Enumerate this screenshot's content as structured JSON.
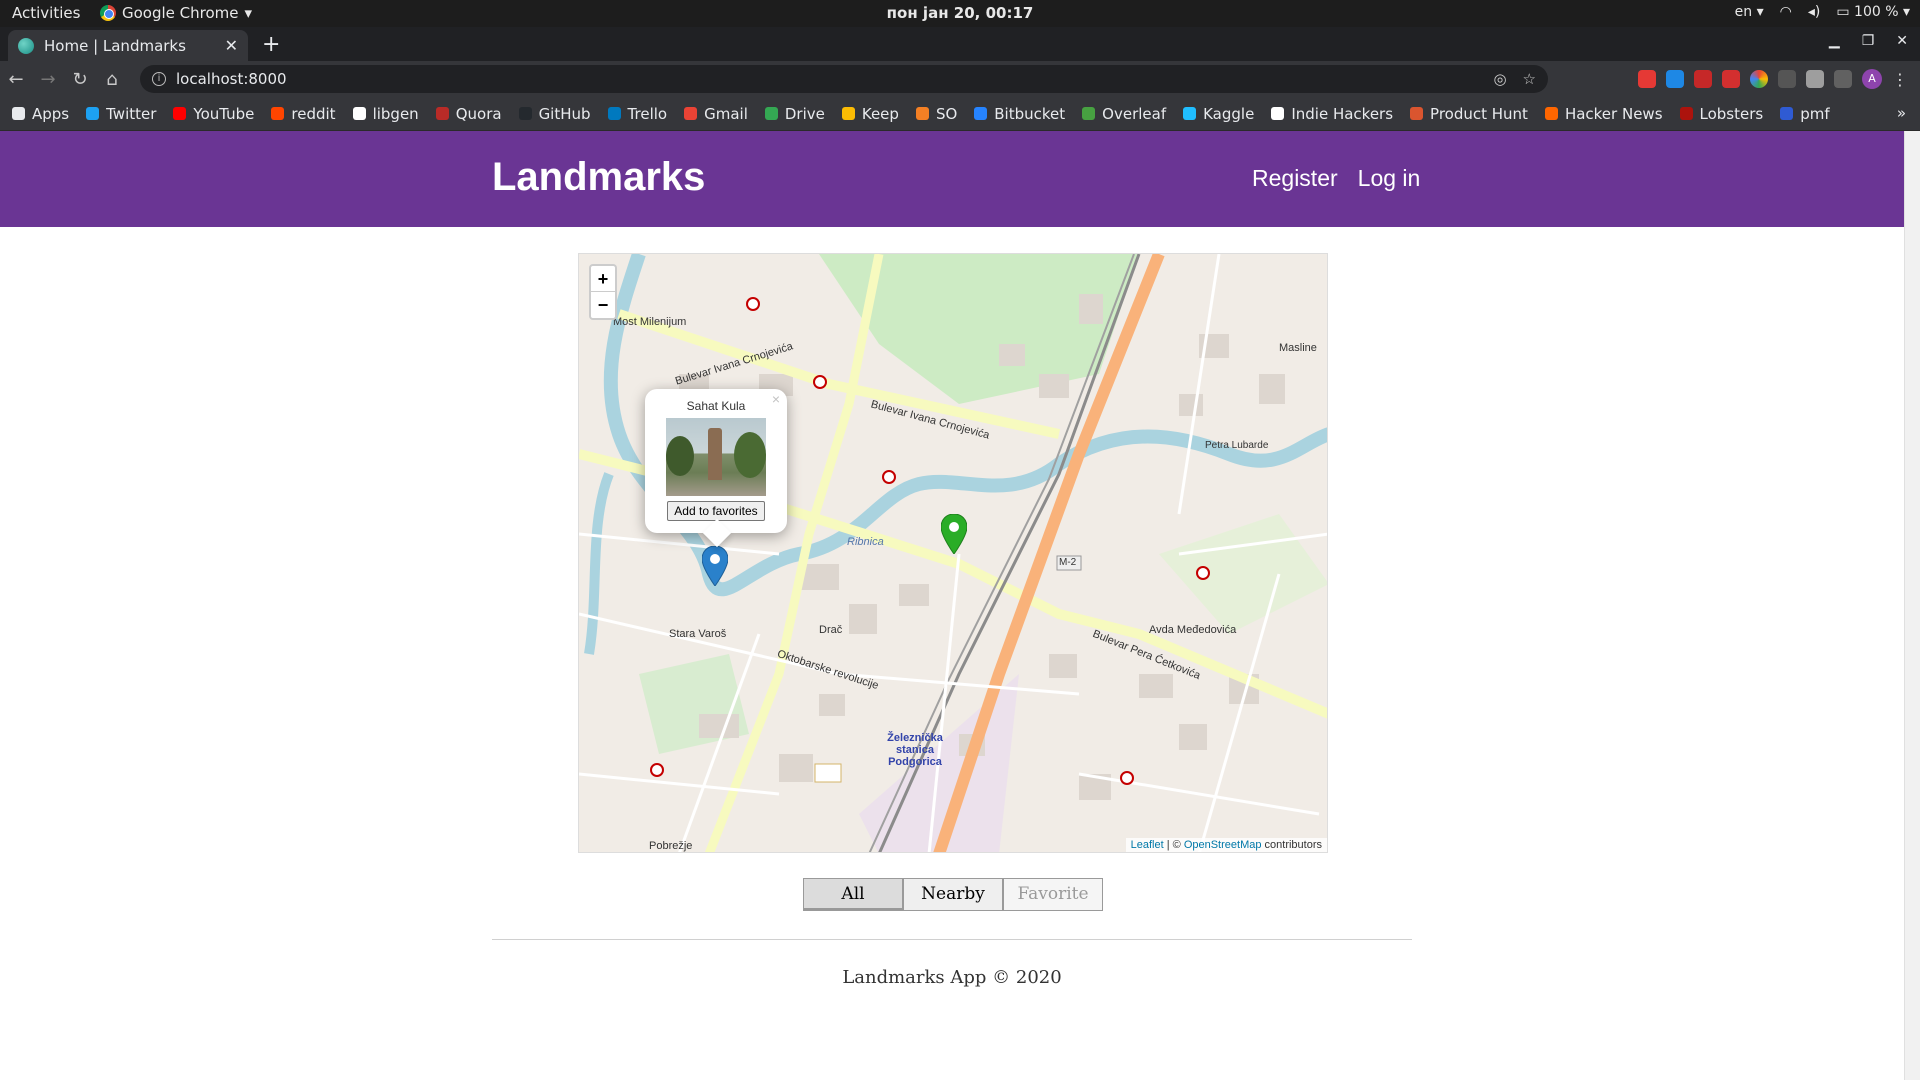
{
  "system_bar": {
    "activities": "Activities",
    "app_name": "Google Chrome",
    "clock": "пон јан 20, 00:17",
    "language": "en",
    "battery": "100 %"
  },
  "browser": {
    "tab_title": "Home | Landmarks",
    "url": "localhost:8000",
    "bookmarks": [
      {
        "label": "Apps",
        "color": "#e8eaed"
      },
      {
        "label": "Twitter",
        "color": "#1da1f2"
      },
      {
        "label": "YouTube",
        "color": "#ff0000"
      },
      {
        "label": "reddit",
        "color": "#ff4500"
      },
      {
        "label": "libgen",
        "color": "#ffffff"
      },
      {
        "label": "Quora",
        "color": "#b92b27"
      },
      {
        "label": "GitHub",
        "color": "#24292e"
      },
      {
        "label": "Trello",
        "color": "#0079bf"
      },
      {
        "label": "Gmail",
        "color": "#ea4335"
      },
      {
        "label": "Drive",
        "color": "#34a853"
      },
      {
        "label": "Keep",
        "color": "#fbbc04"
      },
      {
        "label": "SO",
        "color": "#f48024"
      },
      {
        "label": "Bitbucket",
        "color": "#2684ff"
      },
      {
        "label": "Overleaf",
        "color": "#47a141"
      },
      {
        "label": "Kaggle",
        "color": "#20beff"
      },
      {
        "label": "Indie Hackers",
        "color": "#ffffff"
      },
      {
        "label": "Product Hunt",
        "color": "#da552f"
      },
      {
        "label": "Hacker News",
        "color": "#ff6600"
      },
      {
        "label": "Lobsters",
        "color": "#ac130d"
      },
      {
        "label": "pmf",
        "color": "#2f5bd3"
      }
    ]
  },
  "navbar": {
    "brand": "Landmarks",
    "links": [
      "Register",
      "Log in"
    ]
  },
  "map": {
    "zoom_in": "+",
    "zoom_out": "−",
    "popup": {
      "title": "Sahat Kula",
      "close": "×",
      "button": "Add to favorites"
    },
    "labels": [
      "Most Milenijum",
      "Bulevar Ivana Crnojevića",
      "Stara Varoš",
      "Oktobarske revolucije",
      "Drač",
      "Železnička stanica Podgorica",
      "Bulevar Pera Ćetkovića",
      "Avda Međedovića",
      "M-2",
      "Ribnica",
      "Pobrežje",
      "Masline",
      "Petra Lubarde"
    ],
    "attribution": {
      "leaflet": "Leaflet",
      "separator": " | © ",
      "osm": "OpenStreetMap",
      "suffix": " contributors"
    }
  },
  "filters": {
    "all": "All",
    "nearby": "Nearby",
    "favorite": "Favorite"
  },
  "footer": "Landmarks App © 2020"
}
